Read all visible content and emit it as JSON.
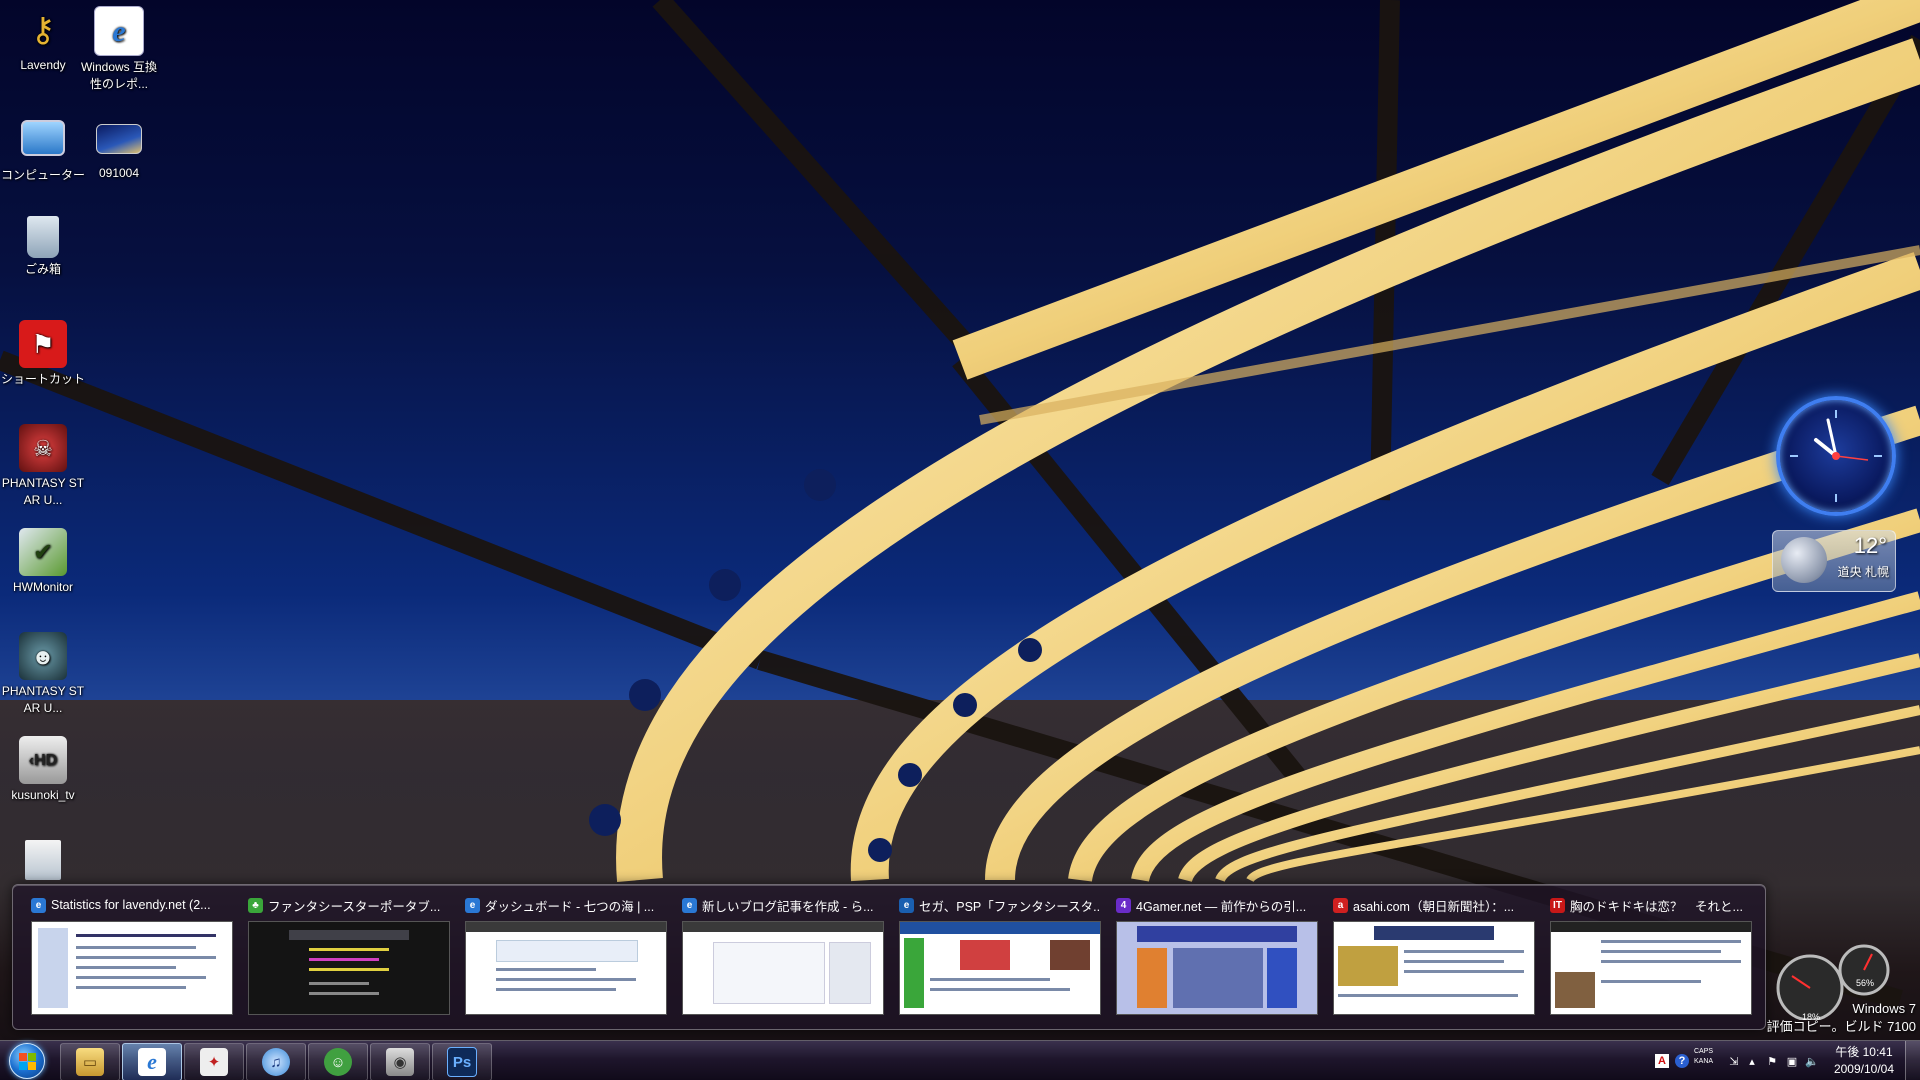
{
  "desktop_icons": [
    {
      "label": "Lavendy",
      "icon": "key-icon"
    },
    {
      "label": "Windows 互換性のレポ...",
      "icon": "internet-explorer-icon"
    },
    {
      "label": "コンピューター",
      "icon": "computer-icon"
    },
    {
      "label": "091004",
      "icon": "wallpaper-file-icon"
    },
    {
      "label": "ごみ箱",
      "icon": "recycle-bin-icon"
    },
    {
      "label": "ショートカット",
      "icon": "shortcut-icon"
    },
    {
      "label": "PHANTASY STAR U...",
      "icon": "game-icon"
    },
    {
      "label": "HWMonitor",
      "icon": "hwmonitor-icon"
    },
    {
      "label": "PHANTASY STAR U...",
      "icon": "game-icon"
    },
    {
      "label": "kusunoki_tv",
      "icon": "hd-shortcut-icon"
    }
  ],
  "weather": {
    "temp": "12°",
    "city": "道央 札幌"
  },
  "meter": {
    "cpu": "18%",
    "mem": "56%"
  },
  "watermark": {
    "line1": "Windows 7",
    "line2": "評価コピー。ビルド 7100"
  },
  "thumbnails": [
    {
      "title": "Statistics for lavendy.net (2...",
      "icon": "ie-icon",
      "icon_color": "#2a78d4"
    },
    {
      "title": "ファンタシースターポータブ...",
      "icon": "clover-icon",
      "icon_color": "#3aa63a"
    },
    {
      "title": "ダッシュボード - 七つの海 | ...",
      "icon": "ie-icon",
      "icon_color": "#2a78d4"
    },
    {
      "title": "新しいブログ記事を作成 - ら...",
      "icon": "ie-icon",
      "icon_color": "#2a78d4"
    },
    {
      "title": "セガ、PSP「ファンタシースタ...",
      "icon": "ie-icon",
      "icon_color": "#1a5fb0"
    },
    {
      "title": "4Gamer.net ― 前作からの引...",
      "icon": "4gamer-icon",
      "icon_color": "#6a2cc8"
    },
    {
      "title": "asahi.com（朝日新聞社）：...",
      "icon": "asahi-icon",
      "icon_color": "#d02020"
    },
    {
      "title": "胸のドキドキは恋？　それと...",
      "icon": "itmedia-icon",
      "icon_color": "#c81818"
    }
  ],
  "taskbar": {
    "buttons": [
      {
        "name": "explorer",
        "icon": "folder-icon",
        "glyph": "▭",
        "color": "#e0b040"
      },
      {
        "name": "internet-explorer",
        "icon": "ie-icon",
        "glyph": "e",
        "color": "#2a78d4",
        "active": true
      },
      {
        "name": "app",
        "icon": "app-icon",
        "glyph": "✦",
        "color": "#c02020"
      },
      {
        "name": "itunes",
        "icon": "itunes-icon",
        "glyph": "♫",
        "color": "#3a8ad8"
      },
      {
        "name": "messenger",
        "icon": "messenger-icon",
        "glyph": "☺",
        "color": "#40a040"
      },
      {
        "name": "media",
        "icon": "media-icon",
        "glyph": "◉",
        "color": "#8a8a8a"
      },
      {
        "name": "photoshop",
        "icon": "photoshop-icon",
        "glyph": "Ps",
        "color": "#1d4e8c"
      }
    ]
  },
  "tray": {
    "caps": "CAPS",
    "kana": "KANA",
    "time": "午後 10:41",
    "date": "2009/10/04"
  }
}
